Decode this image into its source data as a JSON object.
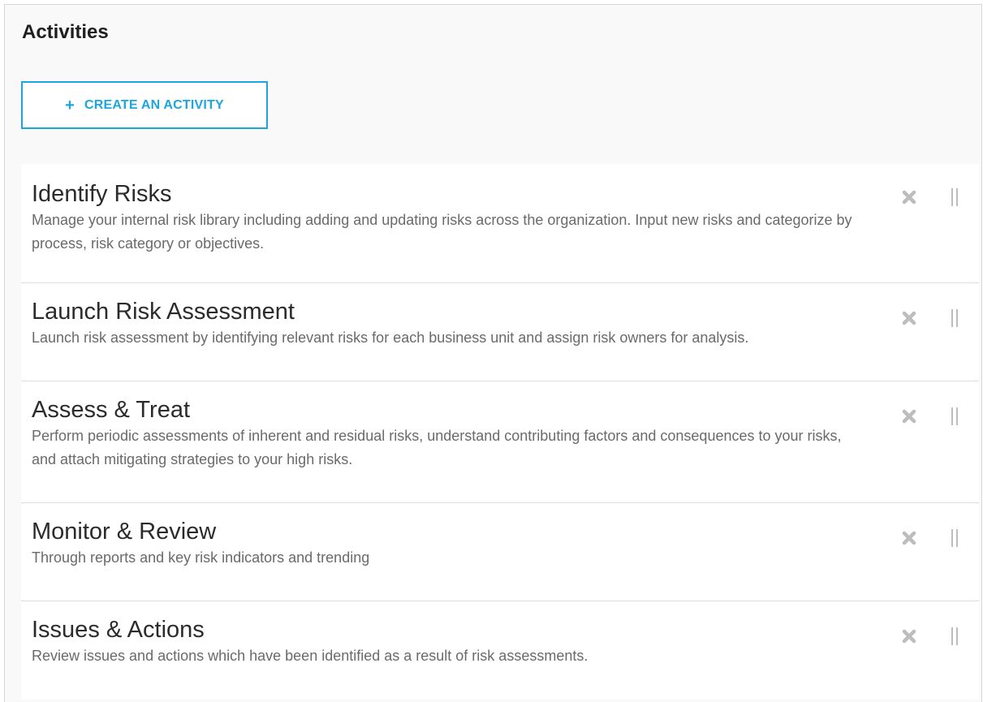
{
  "panel": {
    "title": "Activities",
    "create_button": {
      "icon": "plus-icon",
      "label": "CREATE AN ACTIVITY"
    }
  },
  "activities": [
    {
      "title": "Identify Risks",
      "description": "Manage your internal risk library including adding and updating risks across the organization. Input new risks and categorize by process, risk category or objectives."
    },
    {
      "title": "Launch Risk Assessment",
      "description": "Launch risk assessment by identifying relevant risks for each business unit and assign risk owners for analysis."
    },
    {
      "title": "Assess & Treat",
      "description": "Perform periodic assessments of inherent and residual risks, understand contributing factors and consequences to your risks, and attach mitigating strategies to your high risks."
    },
    {
      "title": "Monitor & Review",
      "description": "Through reports and key risk indicators and trending"
    },
    {
      "title": "Issues & Actions",
      "description": "Review issues and actions which have been identified as a result of risk assessments."
    }
  ],
  "colors": {
    "accent": "#1ba6de",
    "panel_background": "#f9f9f9",
    "title_text": "#1f1f1f",
    "description_text": "#6a6a6a",
    "icon_gray": "#bdbdbd"
  }
}
